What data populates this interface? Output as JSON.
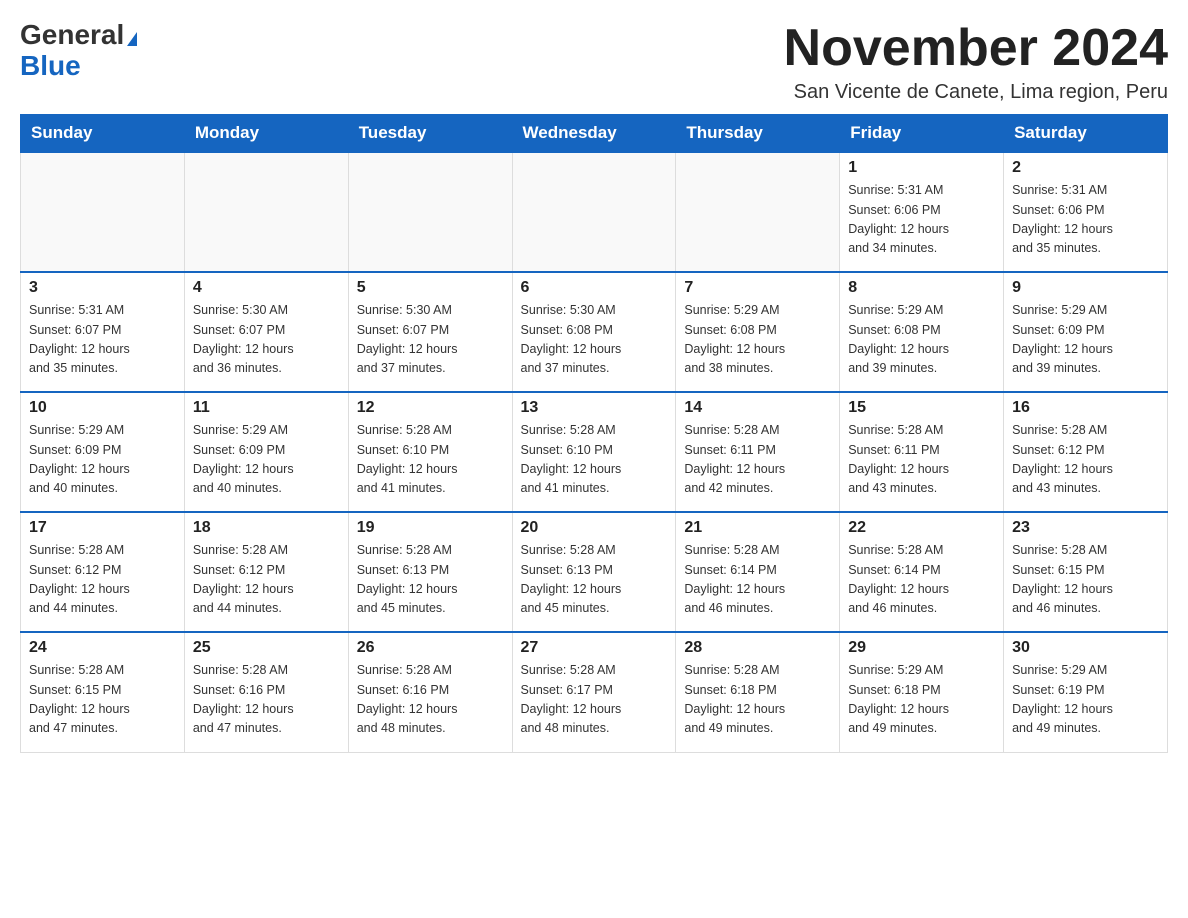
{
  "header": {
    "logo_line1": "General",
    "logo_line2": "Blue",
    "title": "November 2024",
    "subtitle": "San Vicente de Canete, Lima region, Peru"
  },
  "weekdays": [
    "Sunday",
    "Monday",
    "Tuesday",
    "Wednesday",
    "Thursday",
    "Friday",
    "Saturday"
  ],
  "weeks": [
    [
      {
        "day": "",
        "info": ""
      },
      {
        "day": "",
        "info": ""
      },
      {
        "day": "",
        "info": ""
      },
      {
        "day": "",
        "info": ""
      },
      {
        "day": "",
        "info": ""
      },
      {
        "day": "1",
        "info": "Sunrise: 5:31 AM\nSunset: 6:06 PM\nDaylight: 12 hours\nand 34 minutes."
      },
      {
        "day": "2",
        "info": "Sunrise: 5:31 AM\nSunset: 6:06 PM\nDaylight: 12 hours\nand 35 minutes."
      }
    ],
    [
      {
        "day": "3",
        "info": "Sunrise: 5:31 AM\nSunset: 6:07 PM\nDaylight: 12 hours\nand 35 minutes."
      },
      {
        "day": "4",
        "info": "Sunrise: 5:30 AM\nSunset: 6:07 PM\nDaylight: 12 hours\nand 36 minutes."
      },
      {
        "day": "5",
        "info": "Sunrise: 5:30 AM\nSunset: 6:07 PM\nDaylight: 12 hours\nand 37 minutes."
      },
      {
        "day": "6",
        "info": "Sunrise: 5:30 AM\nSunset: 6:08 PM\nDaylight: 12 hours\nand 37 minutes."
      },
      {
        "day": "7",
        "info": "Sunrise: 5:29 AM\nSunset: 6:08 PM\nDaylight: 12 hours\nand 38 minutes."
      },
      {
        "day": "8",
        "info": "Sunrise: 5:29 AM\nSunset: 6:08 PM\nDaylight: 12 hours\nand 39 minutes."
      },
      {
        "day": "9",
        "info": "Sunrise: 5:29 AM\nSunset: 6:09 PM\nDaylight: 12 hours\nand 39 minutes."
      }
    ],
    [
      {
        "day": "10",
        "info": "Sunrise: 5:29 AM\nSunset: 6:09 PM\nDaylight: 12 hours\nand 40 minutes."
      },
      {
        "day": "11",
        "info": "Sunrise: 5:29 AM\nSunset: 6:09 PM\nDaylight: 12 hours\nand 40 minutes."
      },
      {
        "day": "12",
        "info": "Sunrise: 5:28 AM\nSunset: 6:10 PM\nDaylight: 12 hours\nand 41 minutes."
      },
      {
        "day": "13",
        "info": "Sunrise: 5:28 AM\nSunset: 6:10 PM\nDaylight: 12 hours\nand 41 minutes."
      },
      {
        "day": "14",
        "info": "Sunrise: 5:28 AM\nSunset: 6:11 PM\nDaylight: 12 hours\nand 42 minutes."
      },
      {
        "day": "15",
        "info": "Sunrise: 5:28 AM\nSunset: 6:11 PM\nDaylight: 12 hours\nand 43 minutes."
      },
      {
        "day": "16",
        "info": "Sunrise: 5:28 AM\nSunset: 6:12 PM\nDaylight: 12 hours\nand 43 minutes."
      }
    ],
    [
      {
        "day": "17",
        "info": "Sunrise: 5:28 AM\nSunset: 6:12 PM\nDaylight: 12 hours\nand 44 minutes."
      },
      {
        "day": "18",
        "info": "Sunrise: 5:28 AM\nSunset: 6:12 PM\nDaylight: 12 hours\nand 44 minutes."
      },
      {
        "day": "19",
        "info": "Sunrise: 5:28 AM\nSunset: 6:13 PM\nDaylight: 12 hours\nand 45 minutes."
      },
      {
        "day": "20",
        "info": "Sunrise: 5:28 AM\nSunset: 6:13 PM\nDaylight: 12 hours\nand 45 minutes."
      },
      {
        "day": "21",
        "info": "Sunrise: 5:28 AM\nSunset: 6:14 PM\nDaylight: 12 hours\nand 46 minutes."
      },
      {
        "day": "22",
        "info": "Sunrise: 5:28 AM\nSunset: 6:14 PM\nDaylight: 12 hours\nand 46 minutes."
      },
      {
        "day": "23",
        "info": "Sunrise: 5:28 AM\nSunset: 6:15 PM\nDaylight: 12 hours\nand 46 minutes."
      }
    ],
    [
      {
        "day": "24",
        "info": "Sunrise: 5:28 AM\nSunset: 6:15 PM\nDaylight: 12 hours\nand 47 minutes."
      },
      {
        "day": "25",
        "info": "Sunrise: 5:28 AM\nSunset: 6:16 PM\nDaylight: 12 hours\nand 47 minutes."
      },
      {
        "day": "26",
        "info": "Sunrise: 5:28 AM\nSunset: 6:16 PM\nDaylight: 12 hours\nand 48 minutes."
      },
      {
        "day": "27",
        "info": "Sunrise: 5:28 AM\nSunset: 6:17 PM\nDaylight: 12 hours\nand 48 minutes."
      },
      {
        "day": "28",
        "info": "Sunrise: 5:28 AM\nSunset: 6:18 PM\nDaylight: 12 hours\nand 49 minutes."
      },
      {
        "day": "29",
        "info": "Sunrise: 5:29 AM\nSunset: 6:18 PM\nDaylight: 12 hours\nand 49 minutes."
      },
      {
        "day": "30",
        "info": "Sunrise: 5:29 AM\nSunset: 6:19 PM\nDaylight: 12 hours\nand 49 minutes."
      }
    ]
  ]
}
